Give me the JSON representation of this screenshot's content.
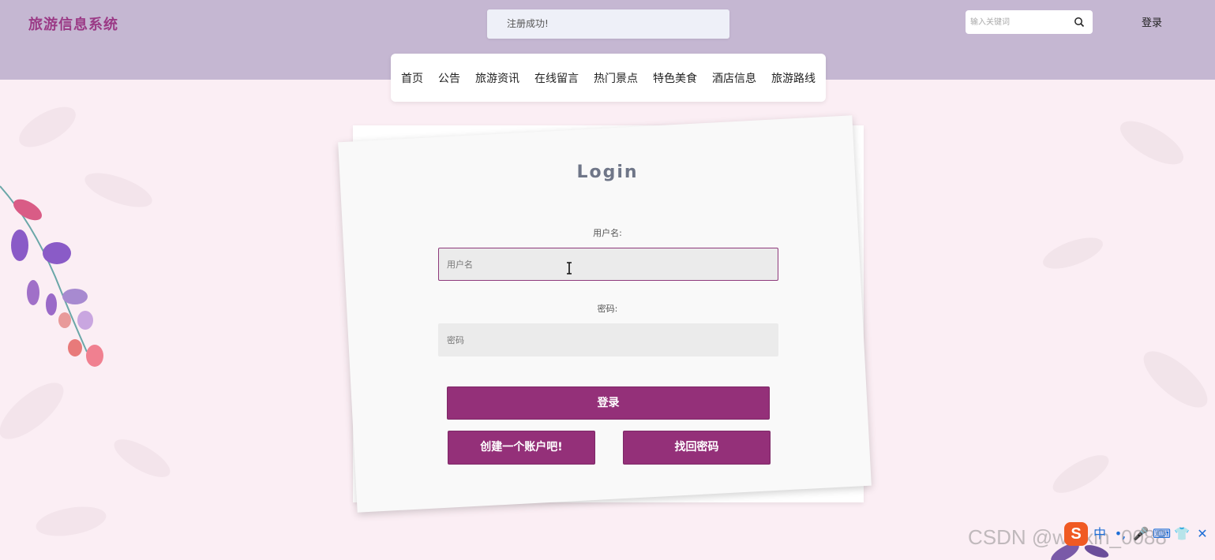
{
  "header": {
    "site_title": "旅游信息系统",
    "toast": "注册成功!",
    "search_placeholder": "输入关键词",
    "login_link": "登录"
  },
  "nav": {
    "items": [
      "首页",
      "公告",
      "旅游资讯",
      "在线留言",
      "热门景点",
      "特色美食",
      "酒店信息",
      "旅游路线"
    ]
  },
  "login_form": {
    "title": "Login",
    "username_label": "用户名:",
    "username_placeholder": "用户名",
    "password_label": "密码:",
    "password_placeholder": "密码",
    "login_button": "登录",
    "register_button": "创建一个账户吧!",
    "forgot_button": "找回密码"
  },
  "overlay": {
    "watermark": "CSDN @weixin_0088",
    "ime_logo": "S",
    "ime_items": [
      "中",
      "•,",
      "🎤",
      "⌨",
      "👕",
      "✕"
    ]
  },
  "colors": {
    "header_bg": "#c5b7d2",
    "accent": "#943079",
    "title": "#9b3a86",
    "page_bg": "#fbeef4"
  }
}
